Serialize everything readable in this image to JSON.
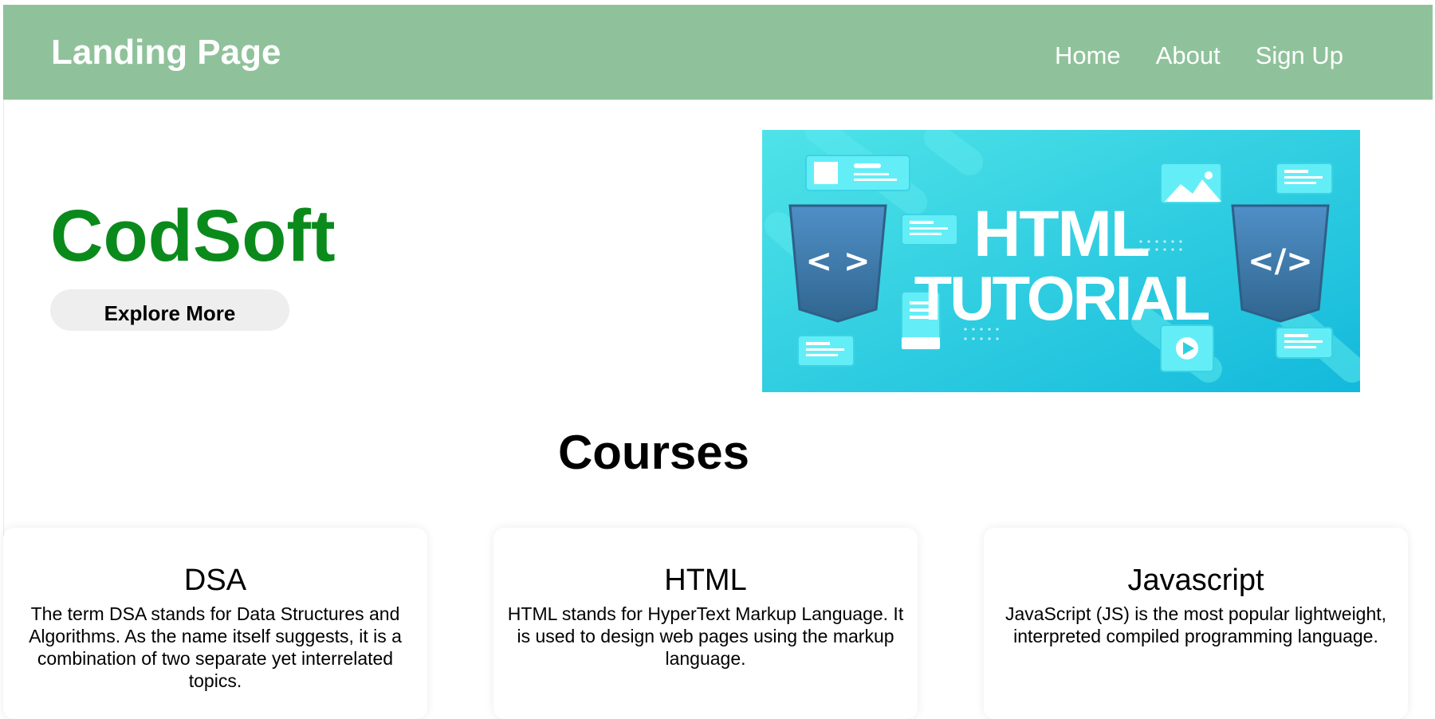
{
  "navbar": {
    "brand": "Landing Page",
    "links": [
      "Home",
      "About",
      "Sign Up"
    ]
  },
  "hero": {
    "title": "CodSoft",
    "button_label": "Explore More",
    "banner": {
      "line1": "HTML",
      "line2": "TUTORIAL",
      "tag_open": "< >",
      "tag_close": "</>"
    }
  },
  "courses": {
    "heading": "Courses",
    "items": [
      {
        "title": "DSA",
        "desc": "The term DSA stands for Data Structures and Algorithms. As the name itself suggests, it is a combination of two separate yet interrelated topics."
      },
      {
        "title": "HTML",
        "desc": "HTML stands for HyperText Markup Language. It is used to design web pages using the markup language."
      },
      {
        "title": "Javascript",
        "desc": "JavaScript (JS) is the most popular lightweight, interpreted compiled programming language."
      }
    ]
  },
  "colors": {
    "navbar": "#8fc29b",
    "brand_green": "#0b8a1c",
    "banner_cyan": "#2ecfe0"
  }
}
